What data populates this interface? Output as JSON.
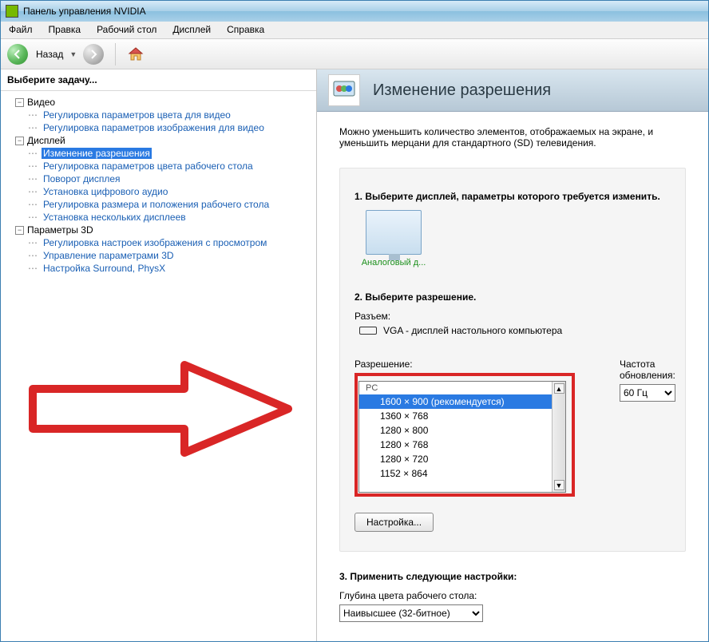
{
  "window": {
    "title": "Панель управления NVIDIA"
  },
  "menu": {
    "file": "Файл",
    "edit": "Правка",
    "desktop": "Рабочий стол",
    "display": "Дисплей",
    "help": "Справка"
  },
  "toolbar": {
    "back": "Назад"
  },
  "left": {
    "header": "Выберите задачу...",
    "video": {
      "label": "Видео",
      "items": [
        "Регулировка параметров цвета для видео",
        "Регулировка параметров изображения для видео"
      ]
    },
    "display": {
      "label": "Дисплей",
      "items": [
        "Изменение разрешения",
        "Регулировка параметров цвета рабочего стола",
        "Поворот дисплея",
        "Установка цифрового аудио",
        "Регулировка размера и положения рабочего стола",
        "Установка нескольких дисплеев"
      ],
      "selected_index": 0
    },
    "params3d": {
      "label": "Параметры 3D",
      "items": [
        "Регулировка настроек изображения с просмотром",
        "Управление параметрами 3D",
        "Настройка Surround, PhysX"
      ]
    }
  },
  "page": {
    "title": "Изменение разрешения",
    "description": "Можно уменьшить количество элементов, отображаемых на экране, и уменьшить мерцани для стандартного (SD) телевидения.",
    "step1": {
      "title": "1. Выберите дисплей, параметры которого требуется изменить.",
      "display_caption": "Аналоговый д..."
    },
    "step2": {
      "title": "2. Выберите разрешение.",
      "connector_label": "Разъем:",
      "connector_value": "VGA - дисплей настольного компьютера",
      "resolution_label": "Разрешение:",
      "res_group": "PC",
      "resolutions": [
        "1600 × 900 (рекомендуется)",
        "1360 × 768",
        "1280 × 800",
        "1280 × 768",
        "1280 × 720",
        "1152 × 864"
      ],
      "selected_res_index": 0,
      "refresh_label": "Частота обновления:",
      "refresh_value": "60 Гц",
      "customize_btn": "Настройка..."
    },
    "step3": {
      "title": "3. Применить следующие настройки:",
      "color_depth_label": "Глубина цвета рабочего стола:",
      "color_depth_value": "Наивысшее (32-битное)"
    }
  }
}
